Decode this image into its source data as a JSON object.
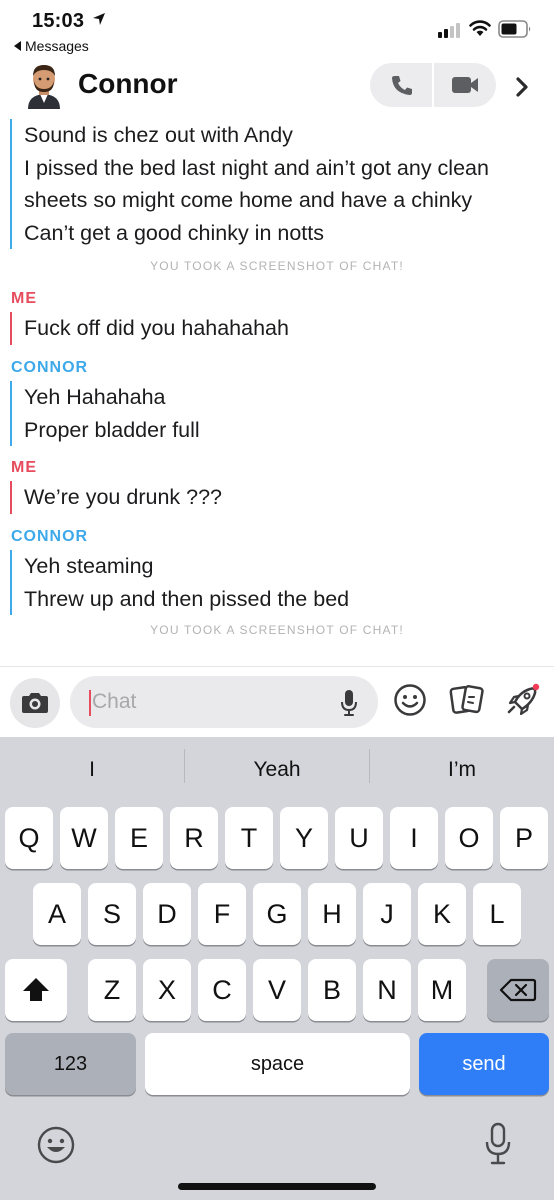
{
  "status_bar": {
    "time": "15:03",
    "back_app": "Messages",
    "icons": [
      "location-arrow-icon",
      "signal-icon",
      "wifi-icon",
      "battery-icon"
    ]
  },
  "header": {
    "title": "Connor",
    "icons": [
      "bitmoji-avatar",
      "phone-icon",
      "video-icon",
      "chevron-right-icon"
    ]
  },
  "colors": {
    "connor": "#3ea9ea",
    "me": "#e64c5e",
    "send_key": "#2f7ef7",
    "keyboard_bg": "#d3d5db"
  },
  "chat": {
    "block1": [
      "Sound is chez out with Andy",
      "I pissed the bed last night and ain’t got any clean",
      "sheets so might come home and have a chinky",
      "Can’t get a good chinky in notts"
    ],
    "notice1": "YOU TOOK A SCREENSHOT OF CHAT!",
    "sender2": "ME",
    "block2": [
      "Fuck off did you hahahahah"
    ],
    "sender3": "CONNOR",
    "block3": [
      "Yeh Hahahaha",
      "Proper bladder full"
    ],
    "sender4": "ME",
    "block4": [
      "We’re you drunk ???"
    ],
    "sender5": "CONNOR",
    "block5": [
      "Yeh steaming",
      "Threw up and then pissed the bed"
    ],
    "notice2": "YOU TOOK A SCREENSHOT OF CHAT!"
  },
  "input_bar": {
    "placeholder": "Chat",
    "icons": [
      "camera-icon",
      "mic-icon",
      "emoji-icon",
      "cards-icon",
      "rocket-icon"
    ]
  },
  "keyboard": {
    "suggestions": [
      "I",
      "Yeah",
      "I’m"
    ],
    "row1": [
      "Q",
      "W",
      "E",
      "R",
      "T",
      "Y",
      "U",
      "I",
      "O",
      "P"
    ],
    "row2": [
      "A",
      "S",
      "D",
      "F",
      "G",
      "H",
      "J",
      "K",
      "L"
    ],
    "row3": [
      "Z",
      "X",
      "C",
      "V",
      "B",
      "N",
      "M"
    ],
    "numbers_key": "123",
    "space_key": "space",
    "send_key": "send"
  }
}
